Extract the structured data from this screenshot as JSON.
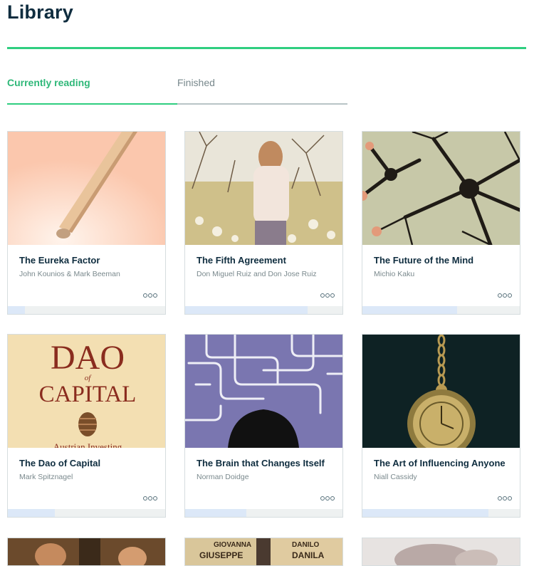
{
  "page": {
    "title": "Library"
  },
  "tabs": [
    {
      "label": "Currently reading",
      "active": true
    },
    {
      "label": "Finished",
      "active": false
    }
  ],
  "accent_color": "#2fce80",
  "books": [
    {
      "title": "The Eureka Factor",
      "author": "John Kounios & Mark Beeman",
      "progress": 0.11
    },
    {
      "title": "The Fifth Agreement",
      "author": "Don Miguel Ruiz and Don Jose Ruiz",
      "progress": 0.78
    },
    {
      "title": "The Future of the Mind",
      "author": "Michio Kaku",
      "progress": 0.6
    },
    {
      "title": "The Dao of Capital",
      "author": "Mark Spitznagel",
      "progress": 0.3
    },
    {
      "title": "The Brain that Changes Itself",
      "author": "Norman Doidge",
      "progress": 0.39
    },
    {
      "title": "The Art of Influencing Anyone",
      "author": "Niall Cassidy",
      "progress": 0.8
    }
  ],
  "covers": {
    "dao": {
      "line1": "DAO",
      "line2": "of",
      "line3": "CAPITAL",
      "line4": "Austrian Investing"
    },
    "row3_middle": {
      "line1": "GIOVANNA",
      "line2": "GIUSEPPE",
      "line3": "DANILO",
      "line4": "DANILA"
    }
  },
  "card_menu_icon": "more-icon"
}
